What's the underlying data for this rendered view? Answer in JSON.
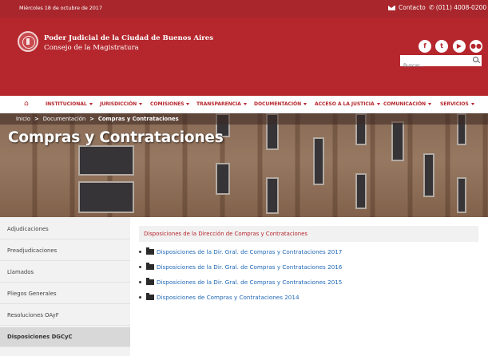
{
  "topbar": {
    "date": "Miércoles 18 de octubre de 2017",
    "contact_label": "Contacto",
    "phone": "(011) 4008-0200"
  },
  "header": {
    "org_name": "Poder Judicial de la Ciudad de Buenos Aires",
    "org_subtitle": "Consejo de la Magistratura",
    "social": [
      "f",
      "t",
      "▶",
      "fk"
    ],
    "search_placeholder": "Buscar..."
  },
  "nav": {
    "items": [
      "INSTITUCIONAL",
      "JURISDICCIÓN",
      "COMISIONES",
      "TRANSPARENCIA",
      "DOCUMENTACIÓN",
      "ACCESO A LA JUSTICIA",
      "COMUNICACIÓN",
      "SERVICIOS"
    ]
  },
  "breadcrumb": {
    "home": "Inicio",
    "level1": "Documentación",
    "current": "Compras y Contrataciones"
  },
  "hero": {
    "title": "Compras y Contrataciones"
  },
  "sidebar": {
    "items": [
      "Adjudicaciones",
      "Preadjudicaciones",
      "Llamados",
      "Pliegos Generales",
      "Resoluciones OAyF",
      "Disposiciones DGCyC"
    ],
    "active_index": 5
  },
  "content": {
    "section_title": "Disposiciones de la Dirección de Compras y Contrataciones",
    "documents": [
      "Disposiciones de la Dir. Gral. de Compras y Contrataciones 2017",
      "Disposiciones de la Dir. Gral. de Compras y Contrataciones 2016",
      "Disposiciones de la Dir. Gral. de Compras y Contrataciones 2015",
      "Disposiciones de Compras y Contrataciones 2014"
    ]
  },
  "colors": {
    "brand_red": "#b5272d",
    "link_blue": "#1f67b5"
  }
}
